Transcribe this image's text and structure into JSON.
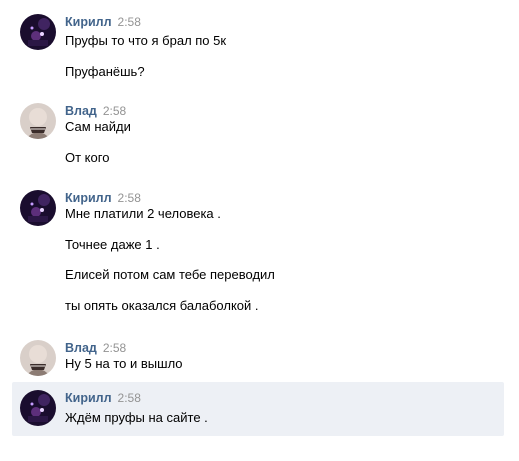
{
  "chat": {
    "messages": [
      {
        "author": "Кирилл",
        "time": "2:58",
        "avatar": "kirill-avatar",
        "lines": [
          "Пруфы то что я брал по 5к",
          "Пруфанёшь?"
        ]
      },
      {
        "author": "Влад",
        "time": "2:58",
        "avatar": "vlad-avatar",
        "lines": [
          "Сам найди",
          "От кого"
        ]
      },
      {
        "author": "Кирилл",
        "time": "2:58",
        "avatar": "kirill-avatar",
        "lines": [
          "Мне платили 2 человека .",
          "Точнее даже 1 .",
          "Елисей потом сам тебе переводил",
          "ты опять оказался балаболкой ."
        ]
      },
      {
        "author": "Влад",
        "time": "2:58",
        "avatar": "vlad-avatar",
        "lines": [
          "Ну 5 на то и вышло"
        ]
      },
      {
        "author": "Кирилл",
        "time": "2:58",
        "avatar": "kirill-avatar",
        "lines": [
          "Ждём пруфы на сайте ."
        ]
      }
    ]
  },
  "colors": {
    "author_link": "#42648b",
    "timestamp": "#939393",
    "highlight_bg": "#edf0f5"
  }
}
